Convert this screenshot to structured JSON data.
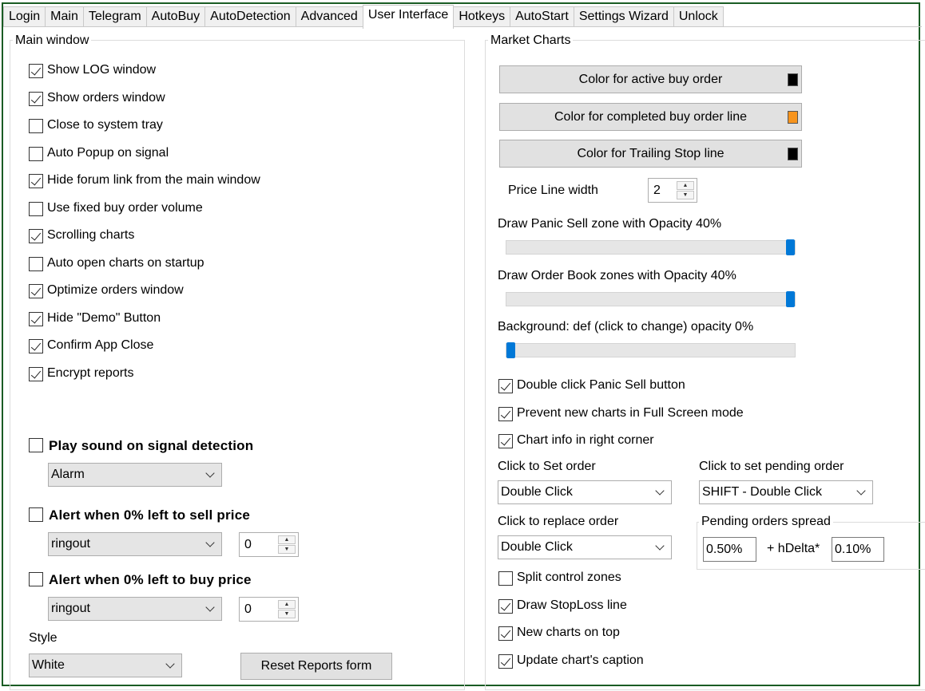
{
  "tabs": [
    "Login",
    "Main",
    "Telegram",
    "AutoBuy",
    "AutoDetection",
    "Advanced",
    "User Interface",
    "Hotkeys",
    "AutoStart",
    "Settings Wizard",
    "Unlock"
  ],
  "active_tab": "User Interface",
  "main_window": {
    "title": "Main window",
    "checkboxes": [
      {
        "label": "Show LOG window",
        "checked": true
      },
      {
        "label": "Show orders window",
        "checked": true
      },
      {
        "label": "Close to system tray",
        "checked": false
      },
      {
        "label": "Auto Popup on signal",
        "checked": false
      },
      {
        "label": "Hide forum link from the main window",
        "checked": true
      },
      {
        "label": "Use fixed buy order volume",
        "checked": false
      },
      {
        "label": "Scrolling charts",
        "checked": true
      },
      {
        "label": "Auto open charts on startup",
        "checked": false
      },
      {
        "label": "Optimize orders window",
        "checked": true
      },
      {
        "label": "Hide \"Demo\" Button",
        "checked": true
      },
      {
        "label": "Confirm App Close",
        "checked": true
      },
      {
        "label": "Encrypt reports",
        "checked": true
      }
    ],
    "play_sound": {
      "label": "Play sound on signal detection",
      "checked": false,
      "sound": "Alarm"
    },
    "alert_sell": {
      "label": "Alert when 0% left to sell price",
      "checked": false,
      "sound": "ringout",
      "value": "0"
    },
    "alert_buy": {
      "label": "Alert when 0% left to buy price",
      "checked": false,
      "sound": "ringout",
      "value": "0"
    },
    "style_label": "Style",
    "style_value": "White",
    "reset_button": "Reset Reports form"
  },
  "market_charts": {
    "title": "Market Charts",
    "color_buttons": [
      {
        "label": "Color for active buy order",
        "color": "#000000"
      },
      {
        "label": "Color for completed buy order line",
        "color": "#f7941d"
      },
      {
        "label": "Color for Trailing Stop line",
        "color": "#000000"
      }
    ],
    "price_line_width_label": "Price Line width",
    "price_line_width": "2",
    "sliders": [
      {
        "label": "Draw Panic Sell zone with Opacity 40%",
        "level": 1.0
      },
      {
        "label": "Draw Order Book zones with Opacity 40%",
        "level": 1.0
      },
      {
        "label": "Background: def (click to change) opacity 0%",
        "level": 0.0
      }
    ],
    "checkboxes_top": [
      {
        "label": "Double click Panic Sell button",
        "checked": true
      },
      {
        "label": "Prevent new charts in Full Screen mode",
        "checked": true
      },
      {
        "label": "Chart info in right corner",
        "checked": true
      }
    ],
    "click_set_order_label": "Click to Set order",
    "click_set_order": "Double Click",
    "click_pending_label": "Click to set pending order",
    "click_pending": "SHIFT - Double Click",
    "click_replace_label": "Click to replace order",
    "click_replace": "Double Click",
    "pending_spread_label": "Pending orders spread",
    "pending_spread": "0.50%",
    "hdelta_label": "+ hDelta*",
    "hdelta": "0.10%",
    "checkboxes_bottom": [
      {
        "label": "Split control zones",
        "checked": false
      },
      {
        "label": "Draw StopLoss line",
        "checked": true
      },
      {
        "label": "New charts on top",
        "checked": true
      },
      {
        "label": "Update chart's caption",
        "checked": true
      }
    ]
  }
}
